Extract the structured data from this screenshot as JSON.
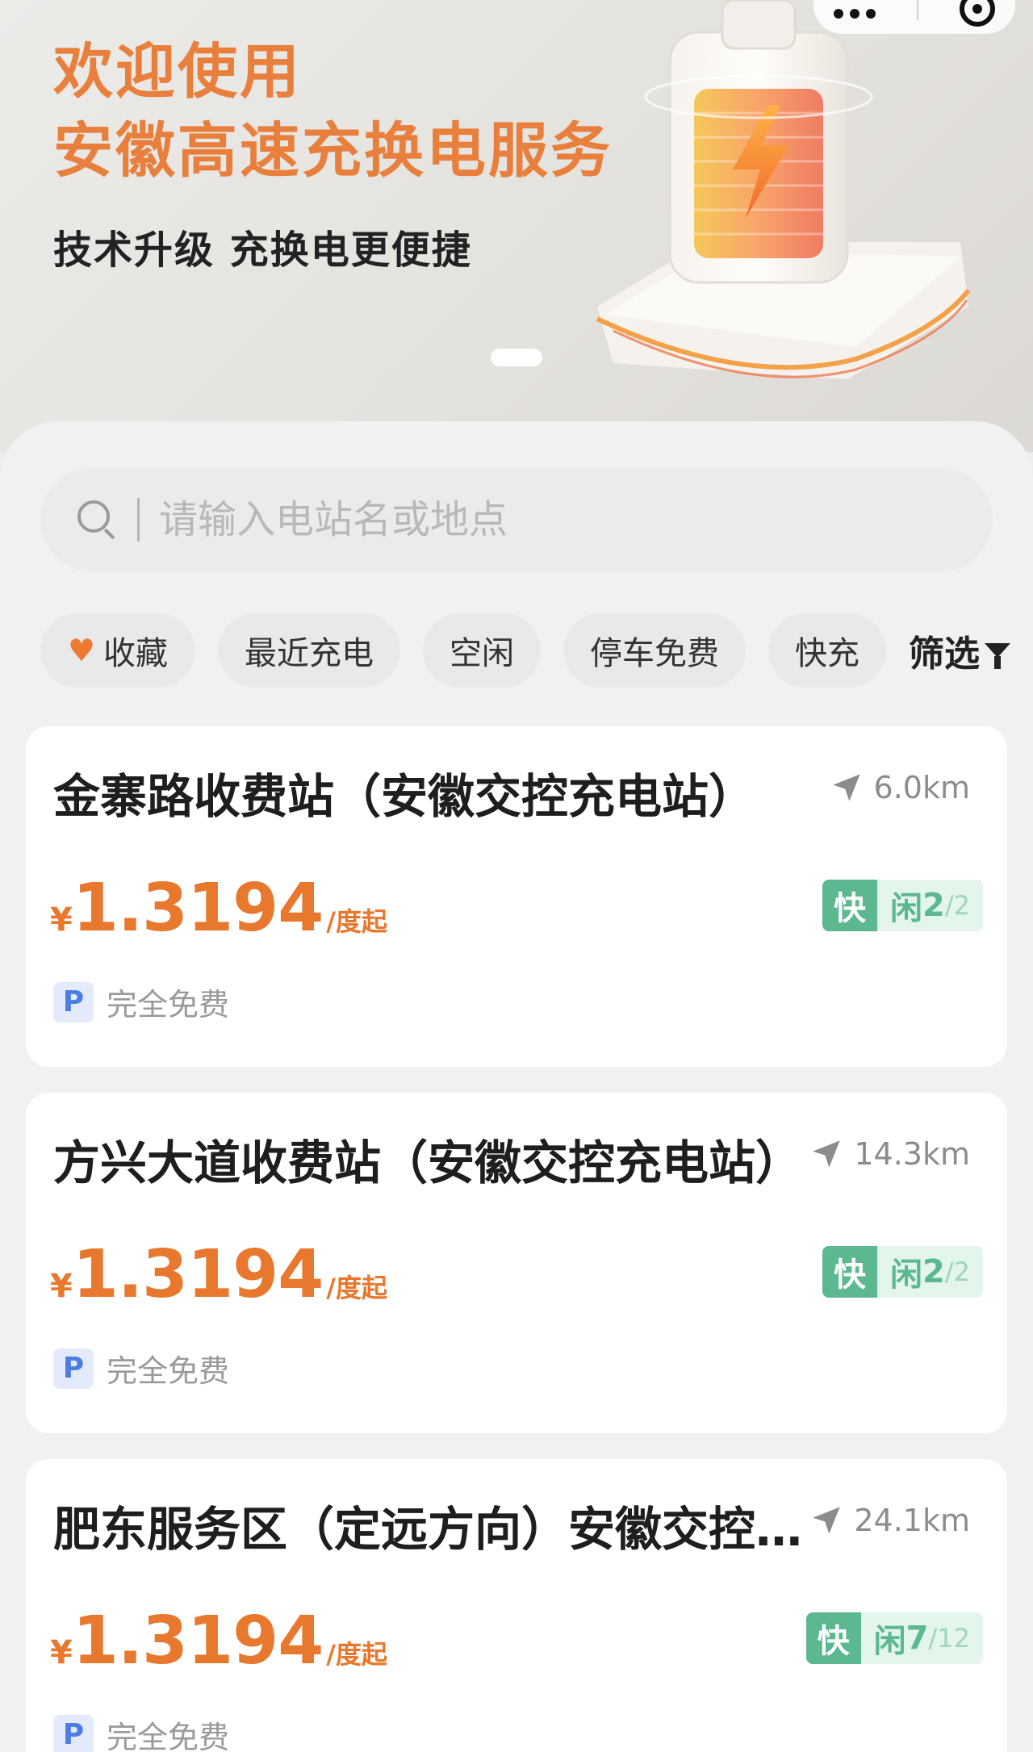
{
  "banner": {
    "title_line1": "欢迎使用",
    "title_line2": "安徽高速充换电服务",
    "subtitle": "技术升级 充换电更便捷"
  },
  "search": {
    "placeholder": "请输入电站名或地点"
  },
  "filters": {
    "favorites": "收藏",
    "recent": "最近充电",
    "idle": "空闲",
    "free_parking": "停车免费",
    "fast": "快充",
    "filter_button": "筛选"
  },
  "stations": [
    {
      "name": "金寨路收费站（安徽交控充电站）",
      "distance": "6.0km",
      "currency": "¥",
      "price": "1.3194",
      "price_unit": "/度起",
      "type": "快",
      "idle_label": "闲",
      "idle_count": "2",
      "total_count": "/2",
      "parking": "完全免费"
    },
    {
      "name": "方兴大道收费站（安徽交控充电站）",
      "distance": "14.3km",
      "currency": "¥",
      "price": "1.3194",
      "price_unit": "/度起",
      "type": "快",
      "idle_label": "闲",
      "idle_count": "2",
      "total_count": "/2",
      "parking": "完全免费"
    },
    {
      "name": "肥东服务区（定远方向）安徽交控充电站",
      "distance": "24.1km",
      "currency": "¥",
      "price": "1.3194",
      "price_unit": "/度起",
      "type": "快",
      "idle_label": "闲",
      "idle_count": "7",
      "total_count": "/12",
      "parking": "完全免费"
    }
  ],
  "colors": {
    "accent_orange": "#e8782e",
    "status_green": "#5cb98f",
    "parking_blue": "#4d7de4"
  }
}
